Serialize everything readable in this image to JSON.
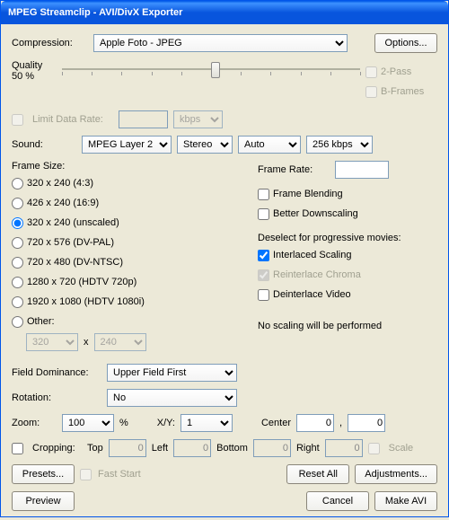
{
  "window": {
    "title": "MPEG Streamclip - AVI/DivX Exporter"
  },
  "compression": {
    "label": "Compression:",
    "value": "Apple Foto - JPEG",
    "options_btn": "Options..."
  },
  "quality": {
    "label": "Quality",
    "percent": "50 %",
    "two_pass": "2-Pass",
    "b_frames": "B-Frames"
  },
  "limit_rate": {
    "label": "Limit Data Rate:",
    "unit": "kbps"
  },
  "sound": {
    "label": "Sound:",
    "codec": "MPEG Layer 2",
    "channels": "Stereo",
    "mode": "Auto",
    "bitrate": "256 kbps"
  },
  "frame_size": {
    "label": "Frame Size:",
    "options": [
      "320 x 240  (4:3)",
      "426 x 240  (16:9)",
      "320 x 240  (unscaled)",
      "720 x 576  (DV-PAL)",
      "720 x 480  (DV-NTSC)",
      "1280 x 720  (HDTV 720p)",
      "1920 x 1080  (HDTV 1080i)",
      "Other:"
    ],
    "selected_index": 2,
    "custom_w": "320",
    "custom_h": "240"
  },
  "frame_rate": {
    "label": "Frame Rate:",
    "value": "",
    "blending": "Frame Blending",
    "downscale": "Better Downscaling"
  },
  "deselect": {
    "label": "Deselect for progressive movies:",
    "interlaced": "Interlaced Scaling",
    "reinterlace": "Reinterlace Chroma",
    "deinterlace": "Deinterlace Video"
  },
  "scaling_note": "No scaling will be performed",
  "field_dominance": {
    "label": "Field Dominance:",
    "value": "Upper Field First"
  },
  "rotation": {
    "label": "Rotation:",
    "value": "No"
  },
  "zoom": {
    "label": "Zoom:",
    "value": "100",
    "pct": "%",
    "xy_label": "X/Y:",
    "xy": "1",
    "center_label": "Center",
    "cx": "0",
    "sep": ",",
    "cy": "0"
  },
  "cropping": {
    "label": "Cropping:",
    "top_l": "Top",
    "top": "0",
    "left_l": "Left",
    "left": "0",
    "bottom_l": "Bottom",
    "bottom": "0",
    "right_l": "Right",
    "right": "0",
    "scale": "Scale"
  },
  "footer": {
    "presets": "Presets...",
    "fast_start": "Fast Start",
    "reset": "Reset All",
    "adjust": "Adjustments...",
    "preview": "Preview",
    "cancel": "Cancel",
    "make": "Make AVI"
  }
}
